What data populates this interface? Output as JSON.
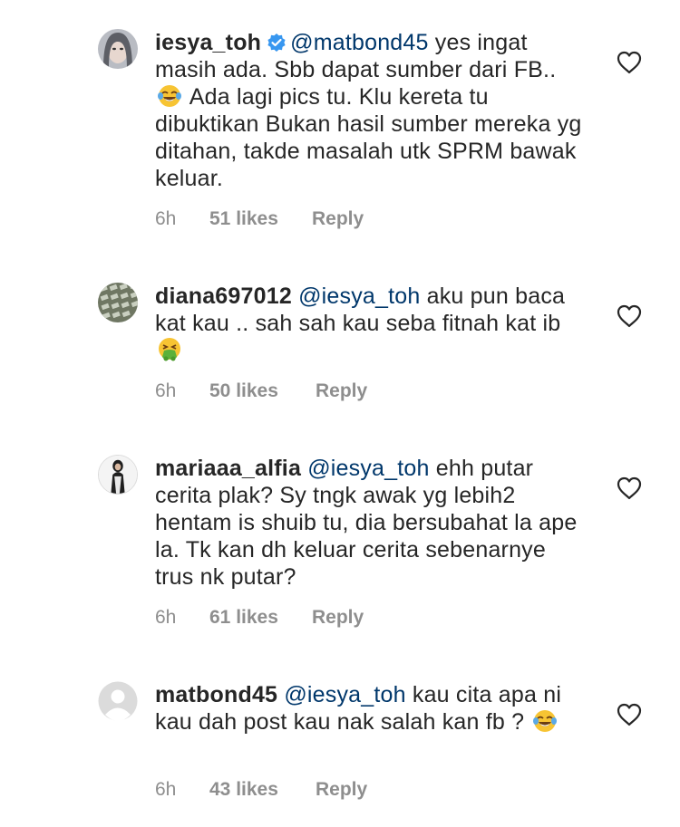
{
  "comments": [
    {
      "username": "iesya_toh",
      "verified": true,
      "mention": "@matbond45",
      "text_parts": [
        " yes ingat masih ada. Sbb dapat sumber dari FB.. ",
        " Ada lagi pics tu. Klu kereta tu dibuktikan Bukan hasil sumber mereka yg ditahan, takde masalah utk SPRM bawak keluar."
      ],
      "emoji": "laughing-tears",
      "time": "6h",
      "likes": "51 likes",
      "reply": "Reply"
    },
    {
      "username": "diana697012",
      "verified": false,
      "mention": "@iesya_toh",
      "text_parts": [
        " aku pun baca kat kau .. sah sah kau seba fitnah kat ib ",
        ""
      ],
      "emoji": "vomiting-face",
      "time": "6h",
      "likes": "50 likes",
      "reply": "Reply"
    },
    {
      "username": "mariaaa_alfia",
      "verified": false,
      "mention": "@iesya_toh",
      "text_parts": [
        " ehh putar cerita plak? Sy tngk awak yg lebih2 hentam is shuib tu, dia bersubahat la ape la. Tk kan dh keluar cerita sebenarnye trus nk putar?",
        ""
      ],
      "emoji": "",
      "time": "6h",
      "likes": "61 likes",
      "reply": "Reply"
    },
    {
      "username": "matbond45",
      "verified": false,
      "mention": "@iesya_toh",
      "text_parts": [
        " kau cita apa ni kau dah post kau nak salah kan fb ? ",
        ""
      ],
      "emoji": "laughing-tears",
      "time": "6h",
      "likes": "43 likes",
      "reply": "Reply"
    }
  ],
  "colors": {
    "username": "#262626",
    "mention": "#00376b",
    "meta": "#8e8e8e",
    "verified": "#3897f0"
  }
}
